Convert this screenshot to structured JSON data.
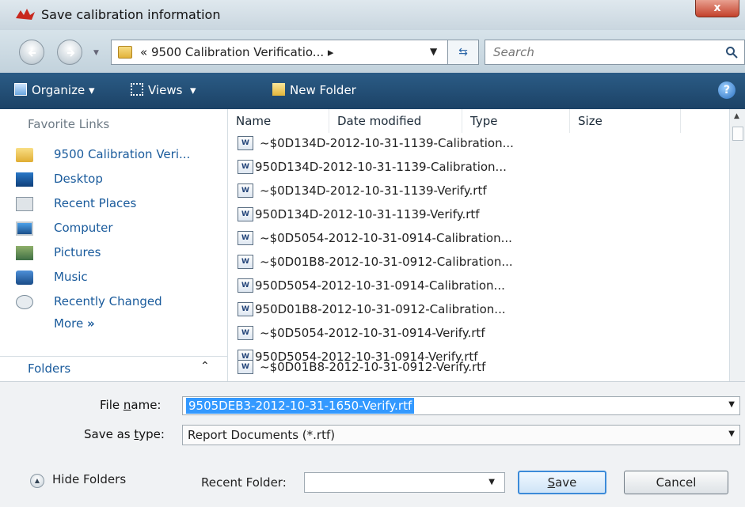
{
  "window": {
    "title": "Save calibration information",
    "close_label": "x"
  },
  "address": {
    "prefix": "«",
    "path": "9500 Calibration Verificatio...",
    "arrow": "▸",
    "search_placeholder": "Search"
  },
  "toolbar": {
    "organize": "Organize",
    "views": "Views",
    "new_folder": "New Folder",
    "help": "?"
  },
  "sidebar": {
    "header": "Favorite Links",
    "items": [
      {
        "label": "9500 Calibration Veri...",
        "icon": "folder-icon"
      },
      {
        "label": "Desktop",
        "icon": "desktop-icon"
      },
      {
        "label": "Recent Places",
        "icon": "recent-places-icon"
      },
      {
        "label": "Computer",
        "icon": "computer-icon"
      },
      {
        "label": "Pictures",
        "icon": "pictures-icon"
      },
      {
        "label": "Music",
        "icon": "music-icon"
      },
      {
        "label": "Recently Changed",
        "icon": "recently-changed-icon"
      }
    ],
    "more": "More",
    "folders": "Folders"
  },
  "filelist": {
    "columns": [
      "Name",
      "Date modified",
      "Type",
      "Size"
    ],
    "files": [
      "~$0D134D-2012-10-31-1139-Calibration...",
      "950D134D-2012-10-31-1139-Calibration...",
      "~$0D134D-2012-10-31-1139-Verify.rtf",
      "950D134D-2012-10-31-1139-Verify.rtf",
      "~$0D5054-2012-10-31-0914-Calibration...",
      "~$0D01B8-2012-10-31-0912-Calibration...",
      "950D5054-2012-10-31-0914-Calibration...",
      "950D01B8-2012-10-31-0912-Calibration...",
      "~$0D5054-2012-10-31-0914-Verify.rtf",
      "950D5054-2012-10-31-0914-Verify.rtf",
      "~$0D01B8-2012-10-31-0912-Verify.rtf"
    ]
  },
  "form": {
    "file_name_label_pre": "File ",
    "file_name_label_u": "n",
    "file_name_label_post": "ame:",
    "file_name_value": "9505DEB3-2012-10-31-1650-Verify.rtf",
    "save_type_label_pre": "Save as ",
    "save_type_label_u": "t",
    "save_type_label_post": "ype:",
    "save_type_value": "Report Documents (*.rtf)",
    "hide_folders": "Hide Folders",
    "recent_folder_label": "Recent Folder:",
    "recent_folder_value": "",
    "save_u": "S",
    "save_rest": "ave",
    "cancel": "Cancel"
  },
  "colors": {
    "toolbar": "#2b5c86",
    "link": "#1a5b9c",
    "selection": "#3399ff"
  }
}
